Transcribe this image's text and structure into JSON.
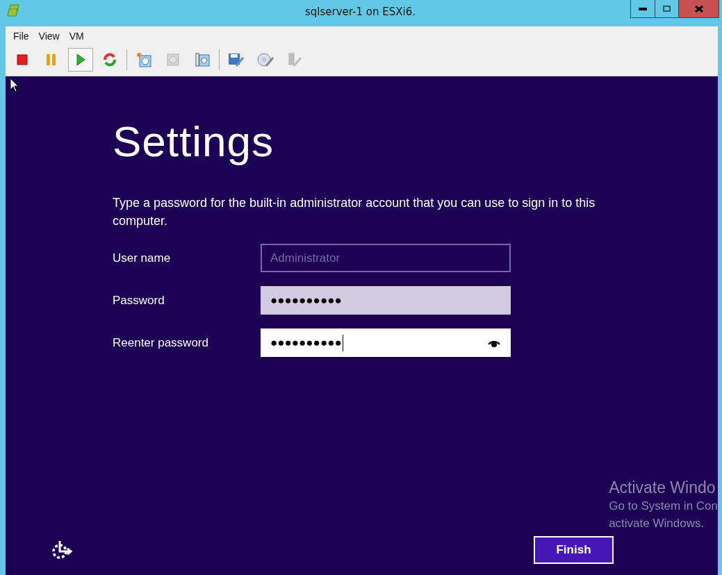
{
  "window": {
    "title": "sqlserver-1 on ESXi6.",
    "controls": [
      {
        "kind": "minimize"
      },
      {
        "kind": "maximize"
      },
      {
        "kind": "close"
      }
    ]
  },
  "menu": [
    "File",
    "View",
    "VM"
  ],
  "toolbar": [
    {
      "kind": "stop",
      "selected": false,
      "disabled": false
    },
    {
      "kind": "pause",
      "selected": false,
      "disabled": false
    },
    {
      "kind": "play",
      "selected": true,
      "disabled": false
    },
    {
      "kind": "reset",
      "selected": false,
      "disabled": false
    },
    {
      "kind": "separator"
    },
    {
      "kind": "snapshot",
      "selected": false,
      "disabled": false
    },
    {
      "kind": "revert",
      "selected": false,
      "disabled": true
    },
    {
      "kind": "manage",
      "selected": false,
      "disabled": false
    },
    {
      "kind": "separator"
    },
    {
      "kind": "floppy",
      "selected": false,
      "disabled": false
    },
    {
      "kind": "cd",
      "selected": false,
      "disabled": false
    },
    {
      "kind": "usb",
      "selected": false,
      "disabled": true
    }
  ],
  "setup": {
    "heading": "Settings",
    "description": "Type a password for the built-in administrator account that you can use to sign in to this computer.",
    "fields": [
      {
        "label": "User name",
        "value": "Administrator",
        "disabled": true,
        "focused": false
      },
      {
        "label": "Password",
        "value": "●●●●●●●●●●",
        "disabled": false,
        "focused": false
      },
      {
        "label": "Reenter password",
        "value": "●●●●●●●●●●",
        "disabled": false,
        "focused": true
      }
    ],
    "finish_button": "Finish"
  },
  "activation_notice": [
    "Activate Windo",
    "Go to System in Con",
    "activate Windows."
  ]
}
